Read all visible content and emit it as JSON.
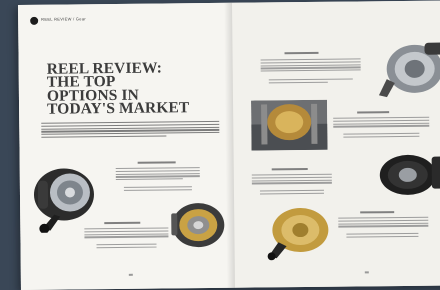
{
  "header": {
    "section_text": "REEL REVIEW / Gear"
  },
  "article": {
    "title_lines": [
      "REEL REVIEW:",
      "THE TOP",
      "OPTIONS IN",
      "TODAY'S MARKET"
    ],
    "byline": ""
  },
  "colors": {
    "background": "#3a4757",
    "page": "#f4f3ef",
    "title": "#3c3c3c",
    "reel_gold": "#c9a244",
    "reel_dark": "#222222",
    "reel_silver": "#a8adb3"
  }
}
